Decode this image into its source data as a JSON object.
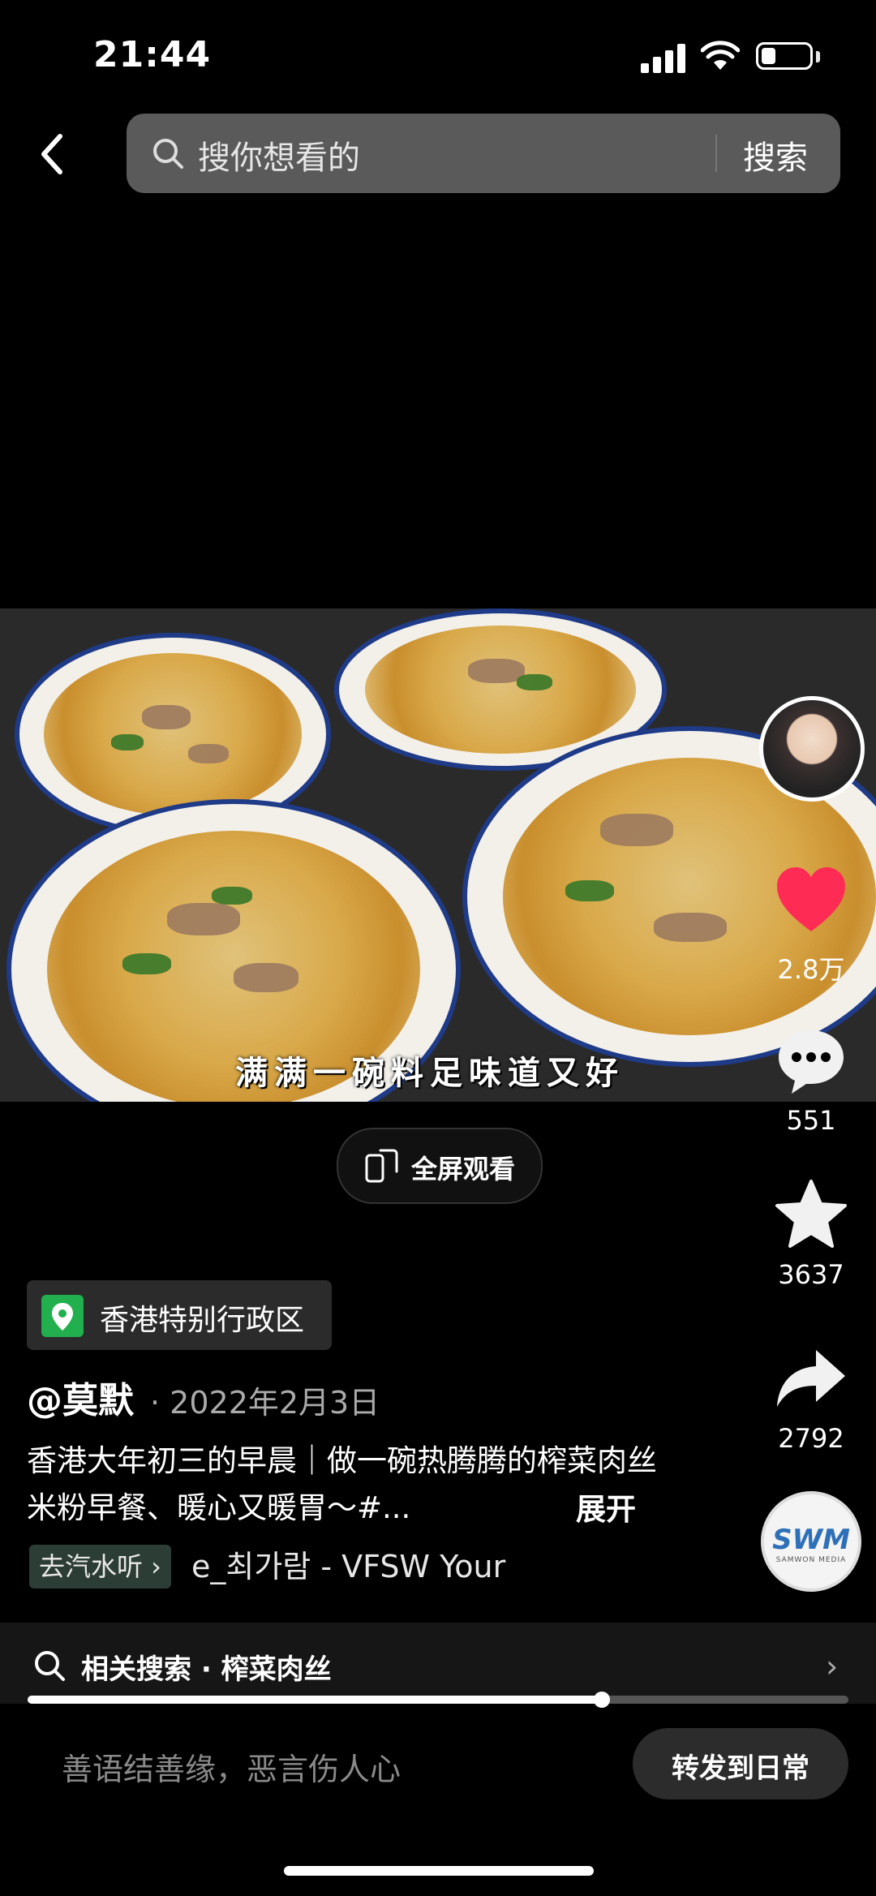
{
  "status_bar": {
    "time": "21:44",
    "battery_level": 0.3
  },
  "search": {
    "placeholder": "搜你想看的",
    "button_label": "搜索"
  },
  "video": {
    "subtitle": "满满一碗料足味道又好",
    "fullscreen_label": "全屏观看"
  },
  "rail": {
    "likes": "2.8万",
    "comments": "551",
    "favorites": "3637",
    "shares": "2792",
    "like_color": "#fe2c55",
    "music_disc_label": "SWM",
    "music_disc_sublabel": "SAMWON MEDIA"
  },
  "post": {
    "location": "香港特别行政区",
    "author": "@莫默",
    "date": "· 2022年2月3日",
    "description": "香港大年初三的早晨｜做一碗热腾腾的榨菜肉丝米粉早餐、暖心又暖胃～#...",
    "expand_label": "展开",
    "music_chip": "去汽水听 ›",
    "music_track": "e_최가람 - VFSW    Your"
  },
  "related": {
    "label": "相关搜索 · 榨菜肉丝",
    "progress": 0.7
  },
  "bottom": {
    "comment_placeholder": "善语结善缘，恶言伤人心",
    "share_daily_label": "转发到日常"
  }
}
